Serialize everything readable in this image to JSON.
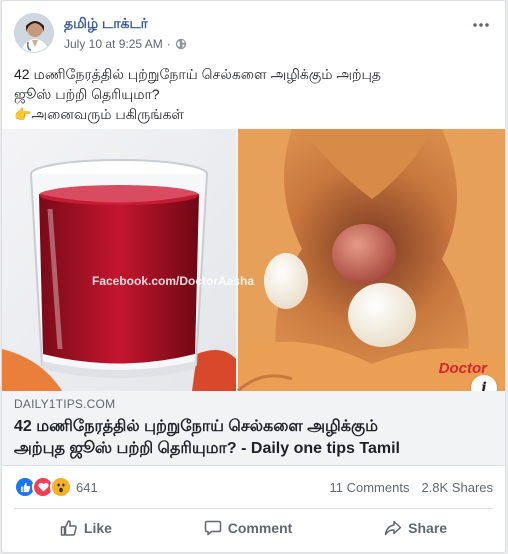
{
  "post": {
    "page_name": "தமிழ் டாக்டர்",
    "timestamp": "July 10 at 9:25 AM",
    "privacy_icon": "globe-icon",
    "more_icon": "more-options-icon",
    "text_lines": [
      "42 மணிநேரத்தில் புற்றுநோய் செல்களை அழிக்கும் அற்புத",
      "ஜூஸ் பற்றி தெரியுமா?",
      "👉அனைவரும் பகிருங்கள்"
    ]
  },
  "media": {
    "watermark": "Facebook.com/DoctorAasha",
    "brand": "Doctor",
    "info_label": "i"
  },
  "link": {
    "domain": "DAILY1TIPS.COM",
    "title_lines": [
      "42 மணிநேரத்தில் புற்றுநோய் செல்களை அழிக்கும்",
      "அற்புத ஜூஸ் பற்றி தெரியுமா? - Daily one tips Tamil"
    ]
  },
  "stats": {
    "reaction_icons": [
      "like-reaction-icon",
      "love-reaction-icon",
      "wow-reaction-icon"
    ],
    "reaction_count": "641",
    "comments": "11 Comments",
    "shares": "2.8K Shares"
  },
  "actions": {
    "like": "Like",
    "comment": "Comment",
    "share": "Share"
  },
  "colors": {
    "link_blue": "#385898",
    "like_blue": "#1877f2",
    "love_red": "#f33e58",
    "wow_yellow": "#f7b125",
    "juice_red": "#b3122a"
  }
}
